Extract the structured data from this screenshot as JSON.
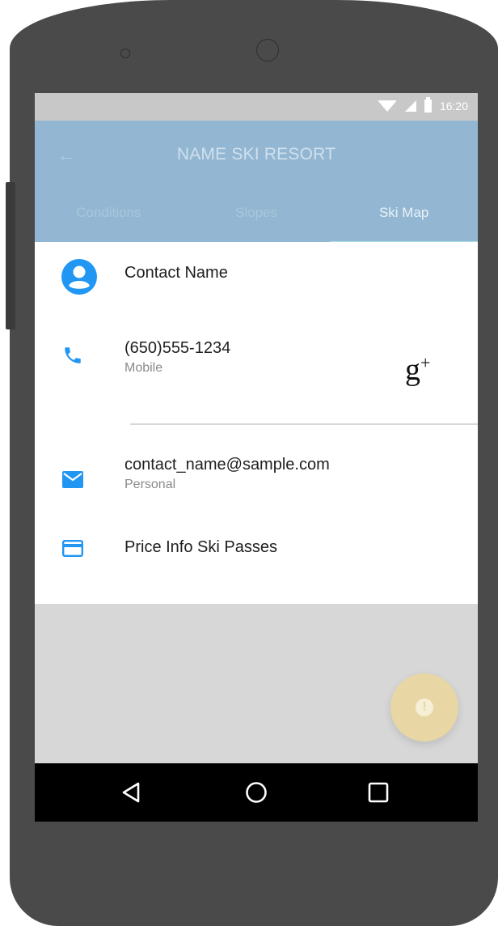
{
  "status_bar": {
    "time": "16:20"
  },
  "app_bar": {
    "title": "NAME SKI RESORT",
    "tabs": [
      {
        "label": "Conditions",
        "active": false
      },
      {
        "label": "Slopes",
        "active": false
      },
      {
        "label": "Ski Map",
        "active": true
      }
    ]
  },
  "details": {
    "contact_name": "Contact Name",
    "phone": {
      "number": "(650)555-1234",
      "type": "Mobile"
    },
    "email": {
      "address": "contact_name@sample.com",
      "type": "Personal"
    },
    "price_info": "Price Info Ski Passes",
    "social": "g+"
  },
  "icons": {
    "accent": "#2196f3",
    "contact": "account-circle-icon",
    "phone": "phone-icon",
    "email": "email-icon",
    "card": "credit-card-icon",
    "fab": "alert-icon"
  },
  "colors": {
    "app_bar": "#93b7d2",
    "tab_indicator": "#a8e0ea",
    "fab": "#e8d7a4"
  }
}
